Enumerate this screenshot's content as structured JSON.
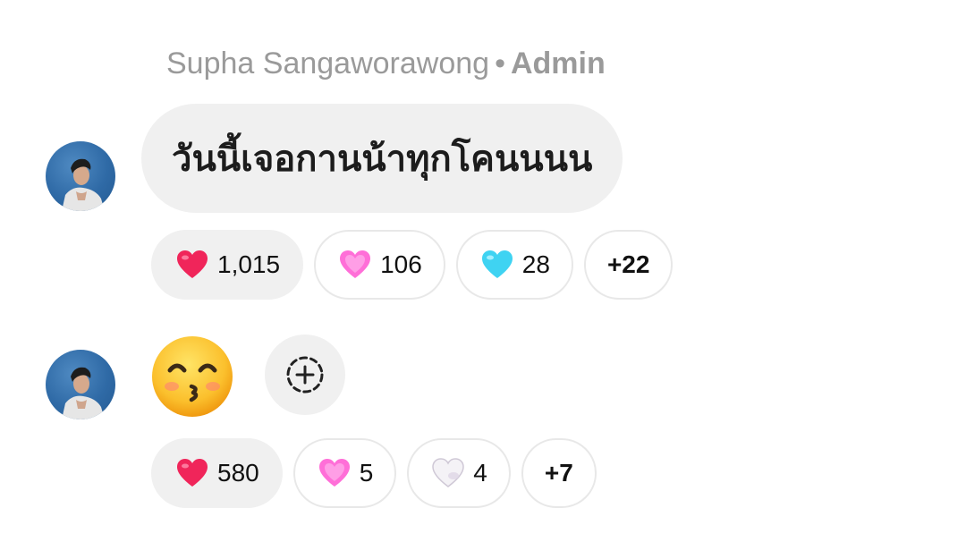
{
  "sender": {
    "name": "Supha Sangaworawong",
    "separator": "•",
    "role": "Admin"
  },
  "messages": [
    {
      "text": "วันนี้เจอกานน้าทุกโคนนนน",
      "reactions": [
        {
          "icon": "red-heart-icon",
          "color": "#f0255a",
          "count": "1,015",
          "active": true
        },
        {
          "icon": "pink-heart-icon",
          "color": "#ff6fd8",
          "count": "106",
          "active": false
        },
        {
          "icon": "light-blue-heart-icon",
          "color": "#3fd3f2",
          "count": "28",
          "active": false
        }
      ],
      "more": "+22"
    },
    {
      "emoji": "kissing-smiling-eyes-emoji",
      "reactions": [
        {
          "icon": "red-heart-icon",
          "color": "#f0255a",
          "count": "580",
          "active": true
        },
        {
          "icon": "pink-heart-icon",
          "color": "#ff6fd8",
          "count": "5",
          "active": false
        },
        {
          "icon": "white-heart-icon",
          "color": "#f4f2f6",
          "count": "4",
          "active": false
        }
      ],
      "more": "+7"
    }
  ],
  "add_reaction_icon": "add-reaction-icon"
}
